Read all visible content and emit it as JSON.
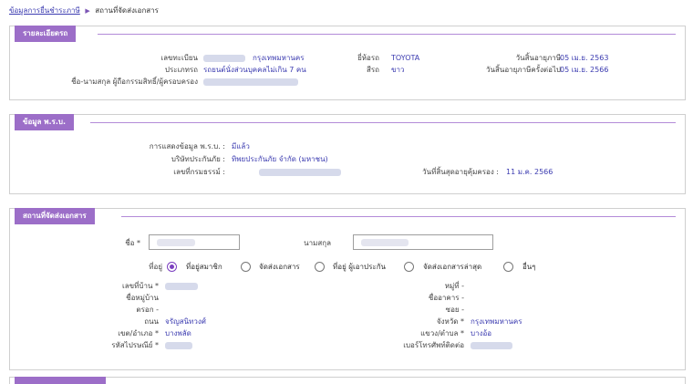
{
  "breadcrumb": {
    "link": "ข้อมูลการยื่นชำระภาษี",
    "separator": "▶",
    "current": "สถานที่จัดส่งเอกสาร"
  },
  "vehicle": {
    "header": "รายละเอียดรถ",
    "reg_label": "เลขทะเบียน",
    "reg_province": "กรุงเทพมหานคร",
    "type_label": "ประเภทรถ",
    "type_value": "รถยนต์นั่งส่วนบุคคลไม่เกิน 7 คน",
    "owner_label": "ชื่อ-นามสกุล ผู้ถือกรรมสิทธิ์/ผู้ครอบครอง",
    "brand_label": "ยี่ห้อรถ",
    "brand_value": "TOYOTA",
    "color_label": "สีรถ",
    "color_value": "ขาว",
    "tax_expiry_label": "วันสิ้นอายุภาษี",
    "tax_expiry_value": "05 เม.ย. 2563",
    "next_expiry_label": "วันสิ้นอายุภาษีครั้งต่อไป",
    "next_expiry_value": "05 เม.ย. 2566"
  },
  "insurance": {
    "header": "ข้อมูล พ.ร.บ.",
    "display_label": "การแสดงข้อมูล พ.ร.บ. :",
    "display_value": "มีแล้ว",
    "company_label": "บริษัทประกันภัย :",
    "company_value": "ทิพยประกันภัย จำกัด (มหาชน)",
    "policy_label": "เลขที่กรมธรรม์ :",
    "coverage_end_label": "วันที่สิ้นสุดอายุคุ้มครอง :",
    "coverage_end_value": "11 ม.ค. 2566"
  },
  "delivery": {
    "header": "สถานที่จัดส่งเอกสาร",
    "first_name_label": "ชื่อ *",
    "last_name_label": "นามสกุล",
    "address_label": "ที่อยู่",
    "address_options": [
      "ที่อยู่สมาชิก",
      "จัดส่งเอกสาร",
      "ที่อยู่ ผู้เอาประกัน",
      "จัดส่งเอกสารล่าสุด",
      "อื่นๆ"
    ],
    "house_no_label": "เลขที่บ้าน *",
    "village_label": "ชื่อหมู่บ้าน",
    "alley_label": "ตรอก -",
    "road_label": "ถนน",
    "road_value": "จรัญสนิทวงศ์",
    "district_label": "เขต/อำเภอ *",
    "district_value": "บางพลัด",
    "postcode_label": "รหัสไปรษณีย์ *",
    "moo_label": "หมู่ที่ -",
    "building_label": "ชื่ออาคาร -",
    "soi_label": "ซอย -",
    "province_label": "จังหวัด *",
    "province_value": "กรุงเทพมหานคร",
    "subdistrict_label": "แขวง/ตำบล *",
    "subdistrict_value": "บางอ้อ",
    "phone_label": "เบอร์โทรศัพท์ติดต่อ"
  },
  "colors": {
    "header_purple": "#9c6ec8",
    "link_blue": "#3b3bb0",
    "radio_selected": "#7b3fc0"
  }
}
